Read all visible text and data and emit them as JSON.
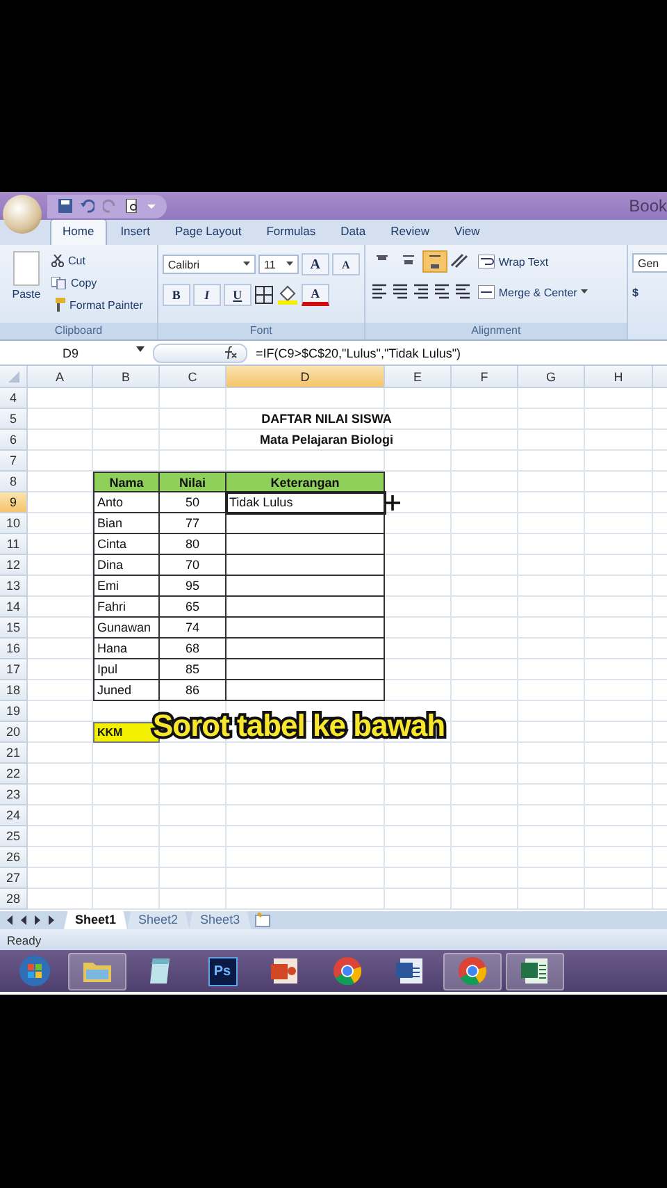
{
  "title_bar": {
    "title": "Book"
  },
  "ribbon_tabs": [
    {
      "label": "Home",
      "selected": true
    },
    {
      "label": "Insert",
      "selected": false
    },
    {
      "label": "Page Layout",
      "selected": false
    },
    {
      "label": "Formulas",
      "selected": false
    },
    {
      "label": "Data",
      "selected": false
    },
    {
      "label": "Review",
      "selected": false
    },
    {
      "label": "View",
      "selected": false
    }
  ],
  "clipboard": {
    "paste": "Paste",
    "cut": "Cut",
    "copy": "Copy",
    "format_painter": "Format Painter",
    "label": "Clipboard"
  },
  "font": {
    "name": "Calibri",
    "size": "11",
    "grow": "A",
    "shrink": "A",
    "styles": [
      "B",
      "I",
      "U"
    ],
    "font_color": "A",
    "label": "Font"
  },
  "alignment": {
    "vertical": [
      {
        "selected": false
      },
      {
        "selected": false
      },
      {
        "selected": true
      }
    ],
    "wrap_text": "Wrap Text",
    "merge_center": "Merge & Center",
    "label": "Alignment"
  },
  "number": {
    "format": "Gen",
    "currency": "$"
  },
  "formula_bar": {
    "name_box": "D9",
    "formula": "=IF(C9>$C$20,\"Lulus\",\"Tidak Lulus\")"
  },
  "columns": [
    {
      "label": "A",
      "selected": false
    },
    {
      "label": "B",
      "selected": false
    },
    {
      "label": "C",
      "selected": false
    },
    {
      "label": "D",
      "selected": true
    },
    {
      "label": "E",
      "selected": false
    },
    {
      "label": "F",
      "selected": false
    },
    {
      "label": "G",
      "selected": false
    },
    {
      "label": "H",
      "selected": false
    }
  ],
  "rows": [
    {
      "label": "4",
      "selected": false
    },
    {
      "label": "5",
      "selected": false
    },
    {
      "label": "6",
      "selected": false
    },
    {
      "label": "7",
      "selected": false
    },
    {
      "label": "8",
      "selected": false
    },
    {
      "label": "9",
      "selected": true
    },
    {
      "label": "10",
      "selected": false
    },
    {
      "label": "11",
      "selected": false
    },
    {
      "label": "12",
      "selected": false
    },
    {
      "label": "13",
      "selected": false
    },
    {
      "label": "14",
      "selected": false
    },
    {
      "label": "15",
      "selected": false
    },
    {
      "label": "16",
      "selected": false
    },
    {
      "label": "17",
      "selected": false
    },
    {
      "label": "18",
      "selected": false
    },
    {
      "label": "19",
      "selected": false
    },
    {
      "label": "20",
      "selected": false
    },
    {
      "label": "21",
      "selected": false
    },
    {
      "label": "22",
      "selected": false
    },
    {
      "label": "23",
      "selected": false
    },
    {
      "label": "24",
      "selected": false
    },
    {
      "label": "25",
      "selected": false
    },
    {
      "label": "26",
      "selected": false
    },
    {
      "label": "27",
      "selected": false
    },
    {
      "label": "28",
      "selected": false
    }
  ],
  "sheet_title": [
    "DAFTAR NILAI SISWA",
    "Mata Pelajaran Biologi"
  ],
  "table": {
    "columns": [
      "Nama",
      "Nilai",
      "Keterangan"
    ],
    "rows": [
      {
        "nama": "Anto",
        "nilai": "50",
        "keterangan": "Tidak Lulus",
        "selected": true
      },
      {
        "nama": "Bian",
        "nilai": "77",
        "selected": false
      },
      {
        "nama": "Cinta",
        "nilai": "80",
        "selected": false
      },
      {
        "nama": "Dina",
        "nilai": "70",
        "selected": false
      },
      {
        "nama": "Emi",
        "nilai": "95",
        "selected": false
      },
      {
        "nama": "Fahri",
        "nilai": "65",
        "selected": false
      },
      {
        "nama": "Gunawan",
        "nilai": "74",
        "selected": false
      },
      {
        "nama": "Hana",
        "nilai": "68",
        "selected": false
      },
      {
        "nama": "Ipul",
        "nilai": "85",
        "selected": false
      },
      {
        "nama": "Juned",
        "nilai": "86",
        "selected": false
      }
    ]
  },
  "kkm": {
    "label": "KKM"
  },
  "caption": "Sorot tabel ke bawah",
  "sheet_tabs": [
    {
      "label": "Sheet1",
      "selected": true
    },
    {
      "label": "Sheet2",
      "selected": false
    },
    {
      "label": "Sheet3",
      "selected": false
    }
  ],
  "status_bar": {
    "text": "Ready"
  },
  "taskbar": [
    {
      "kind": "start",
      "highlighted": false
    },
    {
      "kind": "folder",
      "highlighted": true
    },
    {
      "kind": "notes",
      "highlighted": false
    },
    {
      "kind": "photoshop",
      "text": "Ps",
      "highlighted": false
    },
    {
      "kind": "slides",
      "highlighted": false
    },
    {
      "kind": "browser",
      "highlighted": false
    },
    {
      "kind": "document",
      "highlighted": false
    },
    {
      "kind": "browser-profile",
      "highlighted": true
    },
    {
      "kind": "spreadsheet",
      "highlighted": true
    }
  ]
}
